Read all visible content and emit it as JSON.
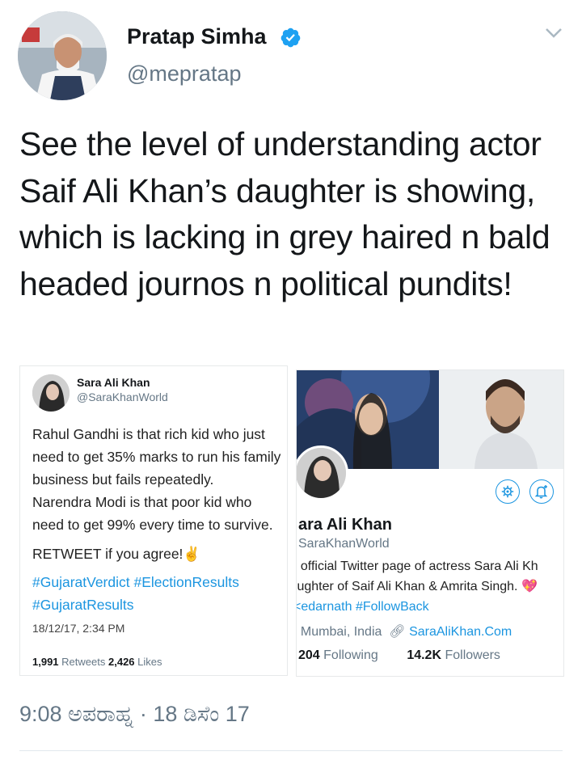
{
  "author": {
    "name": "Pratap Simha",
    "handle": "@mepratap",
    "verified": true,
    "avatar_icon": "profile-photo"
  },
  "tweet": {
    "text": "See the level of understanding actor Saif Ali Khan’s daughter is showing, which is lacking in grey haired n bald headed journos n political pundits!",
    "timestamp": "9:08 ಅಪರಾಹ್ನ · 18 ಡಿಸೆಂ 17"
  },
  "embedded_tweet": {
    "author_name": "Sara Ali Khan",
    "author_handle": "@SaraKhanWorld",
    "text": "Rahul Gandhi is that rich kid who just\nneed to get 35% marks to run his family\nbusiness but fails repeatedly.\nNarendra Modi is that poor kid who\nneed to get 99% every time to survive.",
    "cta": "RETWEET if you agree!✌",
    "hashtags": "#GujaratVerdict #ElectionResults #GujaratResults",
    "time": "18/12/17, 2:34 PM",
    "retweets_count": "1,991",
    "retweets_label": "Retweets",
    "likes_count": "2,426",
    "likes_label": "Likes"
  },
  "embedded_profile": {
    "name": "ara Ali Khan",
    "handle": "SaraKhanWorld",
    "bio_line1": "ı official Twitter page of actress Sara Ali Kh",
    "bio_line2": "ıughter of Saif Ali Khan & Amrita Singh.",
    "bio_line3_tags": "<edarnath #FollowBack",
    "location": "Mumbai, India",
    "website": "SaraAliKhan.Com",
    "following_count": "204",
    "following_label": "Following",
    "followers_count": "14.2K",
    "followers_label": "Followers"
  },
  "colors": {
    "accent": "#1b95e0",
    "muted": "#657786",
    "text": "#14171a"
  }
}
